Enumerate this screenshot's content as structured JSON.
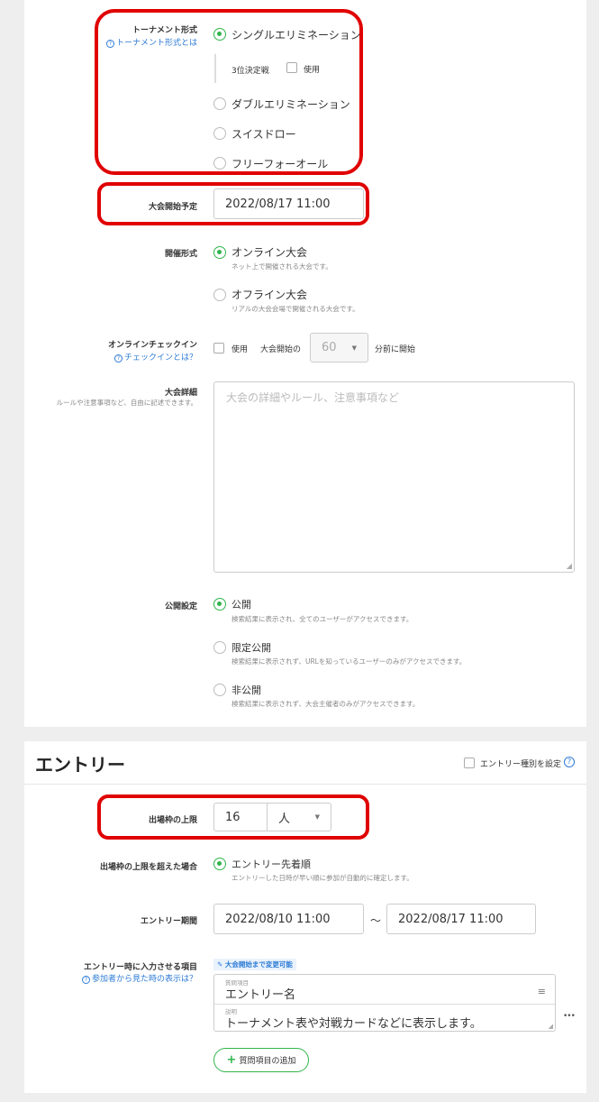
{
  "tournament": {
    "format_label": "トーナメント形式",
    "format_help": "トーナメント形式とは",
    "options": {
      "single": "シングルエリミネーション",
      "double": "ダブルエリミネーション",
      "swiss": "スイスドロー",
      "ffa": "フリーフォーオール"
    },
    "third_place_label": "3位決定戦",
    "third_place_use": "使用",
    "start_label": "大会開始予定",
    "start_value": "2022/08/17 11:00",
    "mode_label": "開催形式",
    "online_label": "オンライン大会",
    "online_desc": "ネット上で開催される大会です。",
    "offline_label": "オフライン大会",
    "offline_desc": "リアルの大会会場で開催される大会です。",
    "checkin_label": "オンラインチェックイン",
    "checkin_help": "チェックインとは？",
    "checkin_use": "使用",
    "checkin_before": "大会開始の",
    "checkin_minutes": "60",
    "checkin_after": "分前に開始",
    "detail_label": "大会詳細",
    "detail_sub": "ルールや注意事項など、自由に記述できます。",
    "detail_placeholder": "大会の詳細やルール、注意事項など",
    "visibility_label": "公開設定",
    "public_label": "公開",
    "public_desc": "検索結果に表示され、全てのユーザーがアクセスできます。",
    "limited_label": "限定公開",
    "limited_desc": "検索結果に表示されず、URLを知っているユーザーのみがアクセスできます。",
    "private_label": "非公開",
    "private_desc": "検索結果に表示されず、大会主催者のみがアクセスできます。"
  },
  "entry": {
    "title": "エントリー",
    "type_setting": "エントリー種別を設定",
    "capacity_label": "出場枠の上限",
    "capacity_value": "16",
    "capacity_unit": "人",
    "overflow_label": "出場枠の上限を超えた場合",
    "overflow_option": "エントリー先着順",
    "overflow_desc": "エントリーした日時が早い順に参加が自動的に確定します。",
    "period_label": "エントリー期間",
    "period_start": "2022/08/10 11:00",
    "period_sep": "～",
    "period_end": "2022/08/17 11:00",
    "fields_label": "エントリー時に入力させる項目",
    "fields_help": "参加者から見た時の表示は？",
    "editable_badge": "大会開始まで変更可能",
    "q_item_caption": "質問項目",
    "q_item_value": "エントリー名",
    "q_desc_caption": "説明",
    "q_desc_value": "トーナメント表や対戦カードなどに表示します。",
    "more": "•••",
    "add_question": "質問項目の追加"
  },
  "colors": {
    "accent_green": "#2fb54b",
    "link_blue": "#2e7bd6",
    "highlight_red": "#e00000"
  }
}
